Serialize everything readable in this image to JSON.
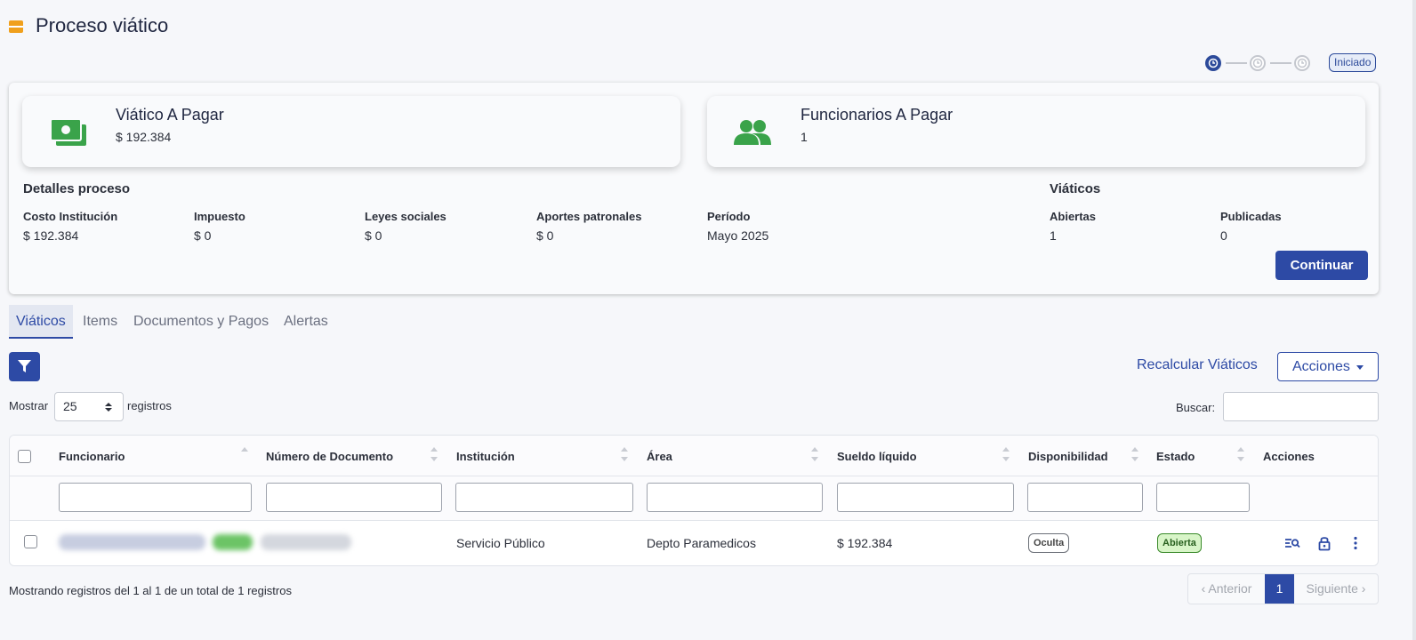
{
  "header": {
    "title": "Proceso viático",
    "status": "Iniciado"
  },
  "colors": {
    "accent": "#2d4aa5",
    "money_icon": "#3aa34a",
    "status_active": "#2c4a9a",
    "badge_green": "#d8f5c8"
  },
  "summary": {
    "viatico": {
      "title": "Viático A Pagar",
      "value": "$ 192.384",
      "icon": "money-icon"
    },
    "funcionarios": {
      "title": "Funcionarios A Pagar",
      "value": "1",
      "icon": "users-icon"
    }
  },
  "details": {
    "heading": "Detalles proceso",
    "items": [
      {
        "label": "Costo Institución",
        "value": "$ 192.384"
      },
      {
        "label": "Impuesto",
        "value": "$ 0"
      },
      {
        "label": "Leyes sociales",
        "value": "$ 0"
      },
      {
        "label": "Aportes patronales",
        "value": "$ 0"
      },
      {
        "label": "Período",
        "value": "Mayo 2025"
      }
    ]
  },
  "viaticos": {
    "heading": "Viáticos",
    "items": [
      {
        "label": "Abiertas",
        "value": "1"
      },
      {
        "label": "Publicadas",
        "value": "0"
      }
    ]
  },
  "continue_label": "Continuar",
  "tabs": [
    {
      "label": "Viáticos",
      "active": true
    },
    {
      "label": "Items"
    },
    {
      "label": "Documentos y Pagos"
    },
    {
      "label": "Alertas"
    }
  ],
  "toolbar": {
    "recalc_label": "Recalcular Viáticos",
    "actions_label": "Acciones"
  },
  "length": {
    "prefix": "Mostrar",
    "value": "25",
    "suffix": "registros"
  },
  "search": {
    "label": "Buscar:"
  },
  "table": {
    "columns": [
      "Funcionario",
      "Número de Documento",
      "Institución",
      "Área",
      "Sueldo líquido",
      "Disponibilidad",
      "Estado",
      "Acciones"
    ],
    "rows": [
      {
        "institucion": "Servicio Público",
        "area": "Depto Paramedicos",
        "sueldo": "$ 192.384",
        "disponibilidad": "Oculta",
        "estado": "Abierta"
      }
    ]
  },
  "footer": {
    "info": "Mostrando registros del 1 al 1 de un total de 1 registros",
    "prev": "Anterior",
    "page": "1",
    "next": "Siguiente"
  }
}
